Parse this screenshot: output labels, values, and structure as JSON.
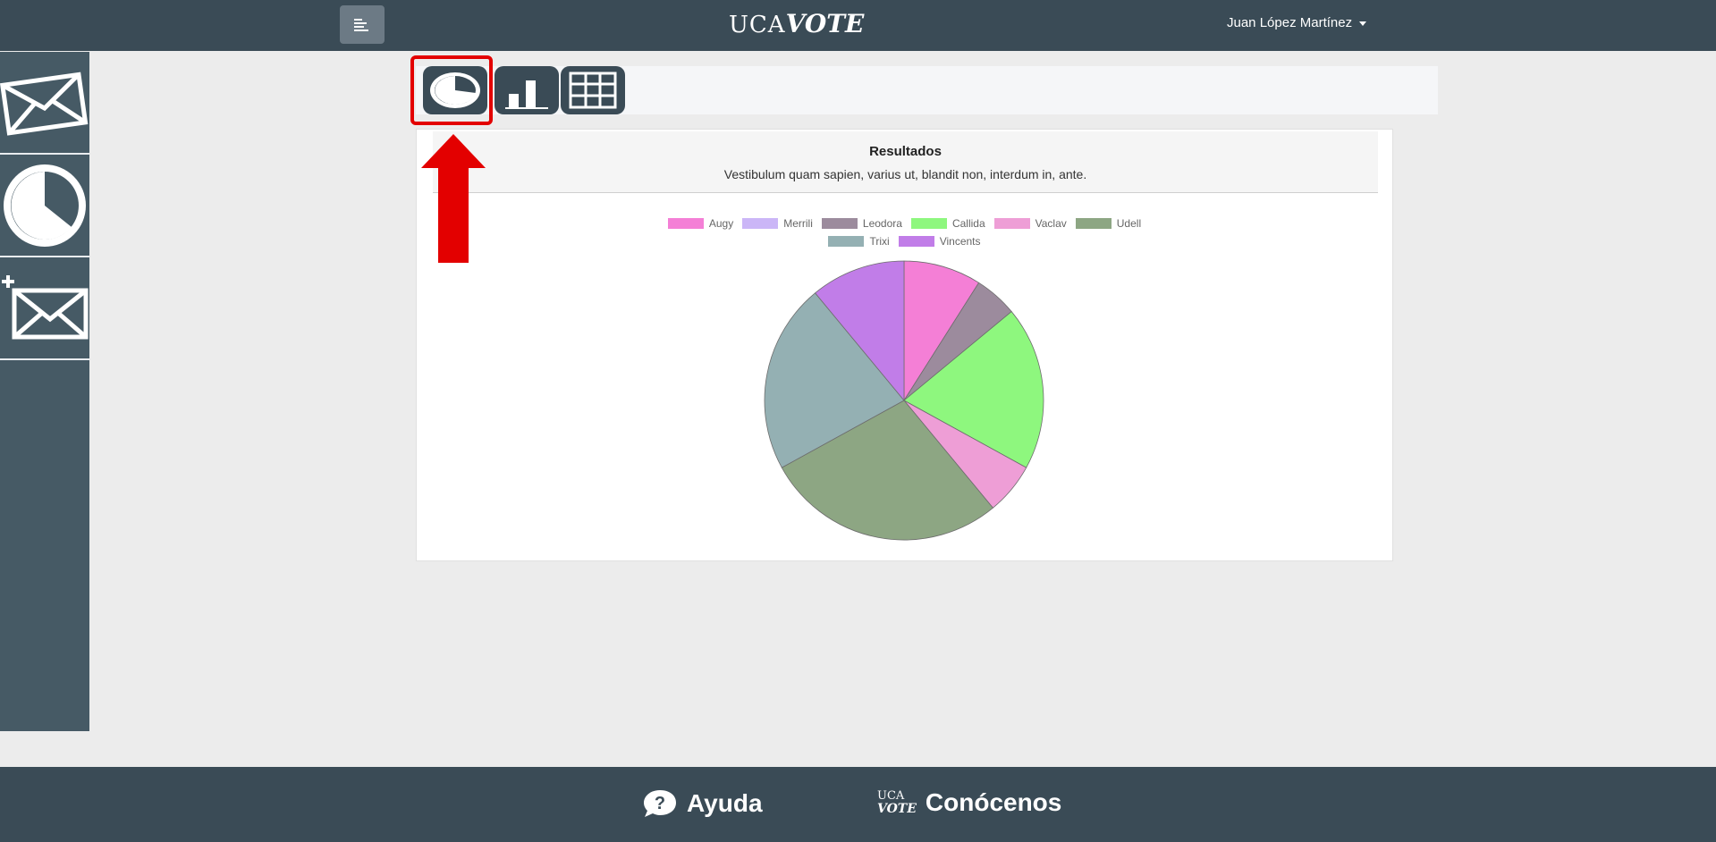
{
  "header": {
    "brand_part1": "UCA",
    "brand_part2": "VOTE",
    "user_name": "Juan López Martínez"
  },
  "sidebar": {
    "items": [
      {
        "icon": "envelope-icon"
      },
      {
        "icon": "pie-chart-icon"
      },
      {
        "icon": "new-envelope-icon"
      }
    ]
  },
  "toolbar": {
    "buttons": [
      {
        "icon": "pie-chart-icon",
        "active": true
      },
      {
        "icon": "bar-chart-icon"
      },
      {
        "icon": "table-icon"
      }
    ]
  },
  "card": {
    "title": "Resultados",
    "subtitle": "Vestibulum quam sapien, varius ut, blandit non, interdum in, ante."
  },
  "chart_data": {
    "type": "pie",
    "title": "",
    "legend_position": "top",
    "series": [
      {
        "label": "Augy",
        "value": 9,
        "color": "#f47fd6"
      },
      {
        "label": "Merrili",
        "value": 0,
        "color": "#cbb6f7"
      },
      {
        "label": "Leodora",
        "value": 5,
        "color": "#9c8b9d"
      },
      {
        "label": "Callida",
        "value": 19,
        "color": "#8ef77e"
      },
      {
        "label": "Vaclav",
        "value": 6,
        "color": "#ee9ed6"
      },
      {
        "label": "Udell",
        "value": 28,
        "color": "#8da683"
      },
      {
        "label": "Trixi",
        "value": 22,
        "color": "#94b0b3"
      },
      {
        "label": "Vincents",
        "value": 11,
        "color": "#c17de8"
      }
    ]
  },
  "footer": {
    "help_label": "Ayuda",
    "about_label": "Conócenos",
    "about_logo_top": "UCA",
    "about_logo_bottom": "VOTE"
  }
}
